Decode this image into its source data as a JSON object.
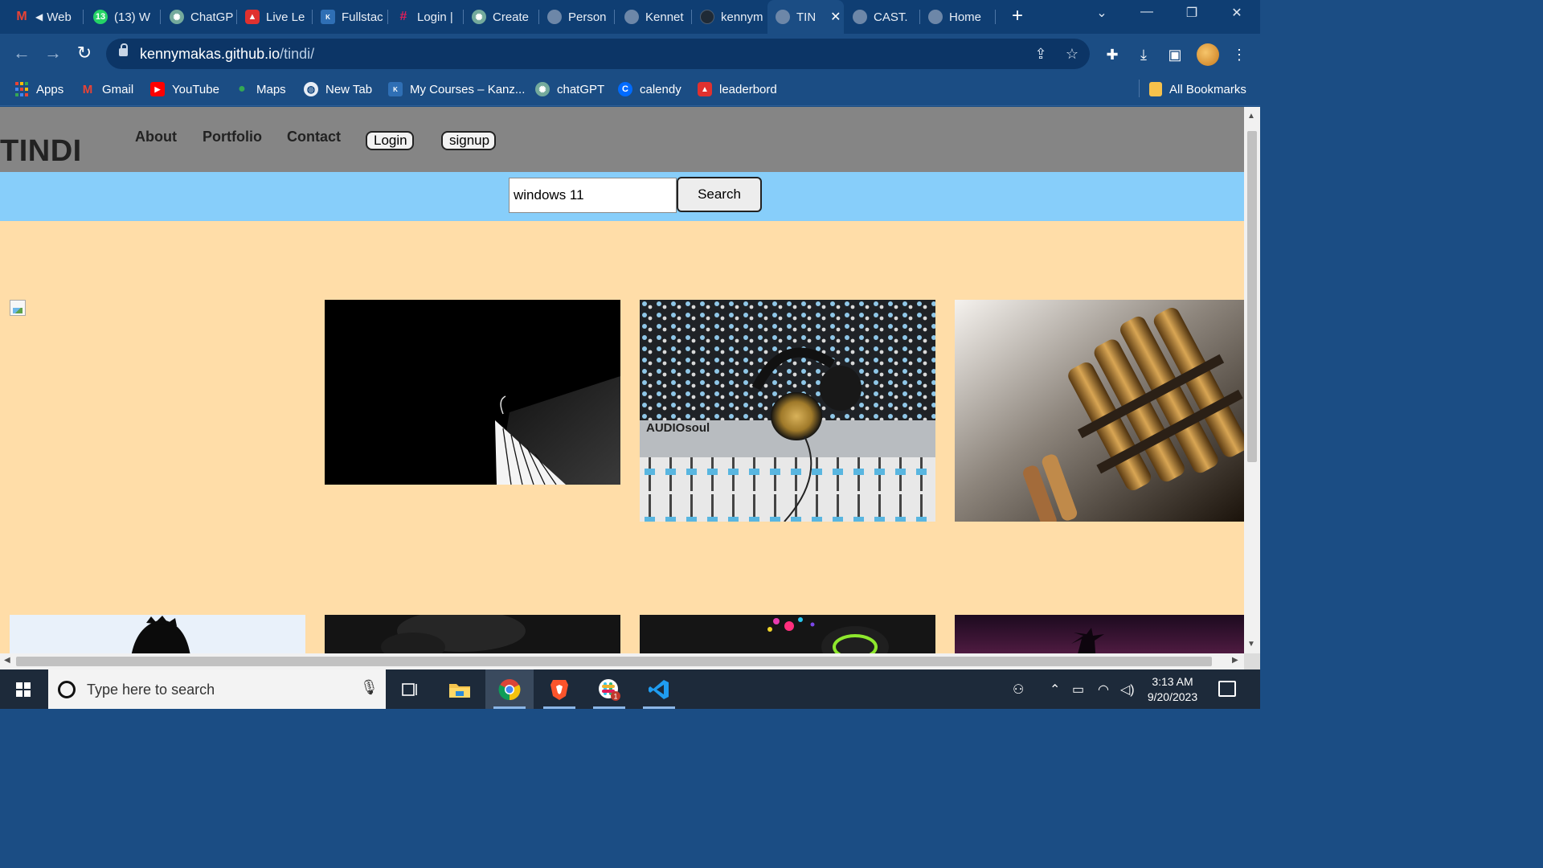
{
  "browser": {
    "tabs": [
      {
        "label": "Web",
        "icon": "gmail-icon",
        "color": "#ea4335"
      },
      {
        "label": "(13) W",
        "icon": "whatsapp-icon",
        "color": "#25d366"
      },
      {
        "label": "ChatGP",
        "icon": "chatgpt-icon",
        "color": "#74aa9c"
      },
      {
        "label": "Live Le",
        "icon": "live-icon",
        "color": "#e0312f"
      },
      {
        "label": "Fullstac",
        "icon": "kanzu-icon",
        "color": "#2f6fb5"
      },
      {
        "label": "Login |",
        "icon": "slack-icon",
        "color": "#e01e5a"
      },
      {
        "label": "Create",
        "icon": "chatgpt-icon",
        "color": "#74aa9c"
      },
      {
        "label": "Person",
        "icon": "globe-icon",
        "color": "#6d87a8"
      },
      {
        "label": "Kennet",
        "icon": "globe-icon",
        "color": "#6d87a8"
      },
      {
        "label": "kennym",
        "icon": "github-icon",
        "color": "#1f2a36"
      },
      {
        "label": "TIN",
        "icon": "globe-icon",
        "color": "#6d87a8"
      },
      {
        "label": "CAST. ",
        "icon": "globe-icon",
        "color": "#6d87a8"
      },
      {
        "label": "Home",
        "icon": "globe-icon",
        "color": "#6d87a8"
      }
    ],
    "url_host": "kennymakas.github.io",
    "url_path": "/tindi/",
    "bookmarks": [
      {
        "label": "Apps",
        "icon": "apps-grid-icon",
        "color": "#ea4335"
      },
      {
        "label": "Gmail",
        "icon": "gmail-icon",
        "color": "#ea4335"
      },
      {
        "label": "YouTube",
        "icon": "youtube-icon",
        "color": "#ff0000"
      },
      {
        "label": "Maps",
        "icon": "maps-icon",
        "color": "#34a853"
      },
      {
        "label": "New Tab",
        "icon": "globe-icon",
        "color": "#e8eef6"
      },
      {
        "label": "My Courses – Kanz...",
        "icon": "kanzu-icon",
        "color": "#2f6fb5"
      },
      {
        "label": "chatGPT",
        "icon": "chatgpt-icon",
        "color": "#74aa9c"
      },
      {
        "label": "calendy",
        "icon": "calendly-icon",
        "color": "#006bff"
      },
      {
        "label": "leaderbord",
        "icon": "leaderboard-icon",
        "color": "#e0312f"
      }
    ],
    "all_bookmarks": "All Bookmarks"
  },
  "site": {
    "logo": "TINDI",
    "nav": [
      "About",
      "Portfolio",
      "Contact"
    ],
    "login_label": "Login",
    "signup_label": "signup",
    "search_value": "windows 11",
    "search_button": "Search",
    "brand_colors": {
      "header": "#858585",
      "searchbar": "#87cefa",
      "background": "#ffdda8"
    }
  },
  "gallery": [
    {
      "subject": "broken-image"
    },
    {
      "subject": "grand-piano-dark"
    },
    {
      "subject": "audio-mixer-headphones"
    },
    {
      "subject": "bullets-closeup"
    },
    {
      "subject": "silhouette-portrait"
    },
    {
      "subject": "dark-scene"
    },
    {
      "subject": "neon-headphones"
    },
    {
      "subject": "purple-sunset-palms"
    }
  ],
  "taskbar": {
    "search_placeholder": "Type here to search",
    "time": "3:13 AM",
    "date": "9/20/2023"
  }
}
